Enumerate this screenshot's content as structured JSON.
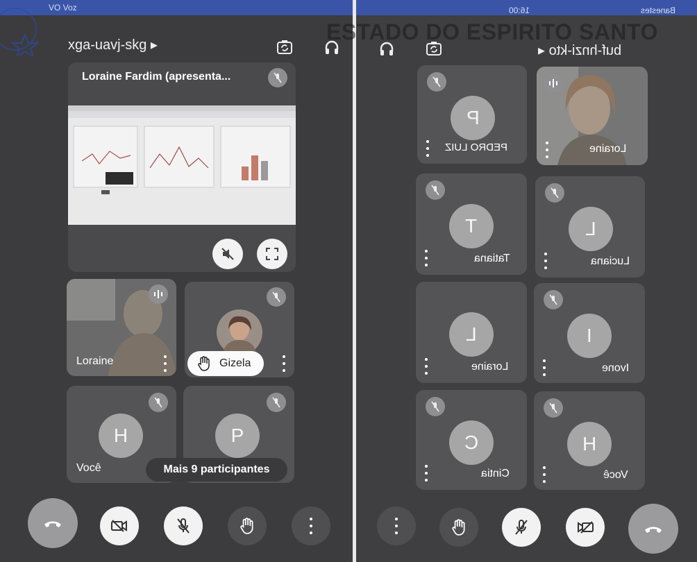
{
  "statusbar": {
    "left_text": "VO Voz",
    "right_time": "16:00",
    "right_carrier": "Banestes"
  },
  "watermark": "ESTADO DO ESPIRITO SANTO",
  "left": {
    "meeting_code": "xga-uavj-skg ▸",
    "presentation": {
      "title": "Loraine Fardim (apresenta..."
    },
    "participants": [
      {
        "name": "Loraine",
        "type": "video"
      },
      {
        "name": "Gizela",
        "type": "raised-hand"
      },
      {
        "name": "Você",
        "initial": "H"
      },
      {
        "name": "Mais 9 participantes",
        "initial": "P"
      }
    ]
  },
  "right": {
    "meeting_code": "buf-hnzi-kto ◂",
    "participants": [
      {
        "name": "PEDRO LUIZ",
        "initial": "P"
      },
      {
        "name": "Loraine",
        "type": "video"
      },
      {
        "name": "Tatiana",
        "initial": "T"
      },
      {
        "name": "Luciana",
        "initial": "L"
      },
      {
        "name": "Loraine",
        "initial": "L"
      },
      {
        "name": "Ivone",
        "initial": "I"
      },
      {
        "name": "Cintia",
        "initial": "C"
      },
      {
        "name": "Você",
        "initial": "H"
      }
    ]
  },
  "colors": {
    "background": "#3c3c3e",
    "tile": "#545456",
    "end_call": "#9b9b9d",
    "statusbar": "#3a55a8"
  }
}
